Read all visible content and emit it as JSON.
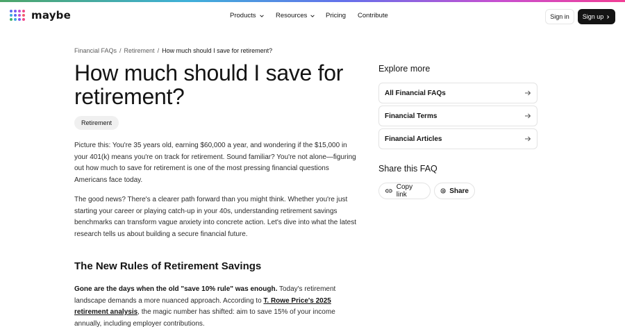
{
  "colors": {
    "accent_dark": "#141414",
    "tag_bg": "#f0f0f0",
    "border": "#e3e3e3"
  },
  "header": {
    "logo_text": "maybe",
    "nav": {
      "products": "Products",
      "resources": "Resources",
      "pricing": "Pricing",
      "contribute": "Contribute"
    },
    "sign_in": "Sign in",
    "sign_up": "Sign up"
  },
  "breadcrumb": {
    "items": [
      "Financial FAQs",
      "Retirement",
      "How much should I save for retirement?"
    ],
    "separator": "/"
  },
  "article": {
    "title": "How much should I save for retirement?",
    "tag": "Retirement",
    "p1": "Picture this: You're 35 years old, earning $60,000 a year, and wondering if the $15,000 in your 401(k) means you're on track for retirement. Sound familiar? You're not alone—figuring out how much to save for retirement is one of the most pressing financial questions Americans face today.",
    "p2": "The good news? There's a clearer path forward than you might think. Whether you're just starting your career or playing catch-up in your 40s, understanding retirement savings benchmarks can transform vague anxiety into concrete action. Let's dive into what the latest research tells us about building a secure financial future.",
    "h2": "The New Rules of Retirement Savings",
    "p3_bold": "Gone are the days when the old \"save 10% rule\" was enough.",
    "p3_a": " Today's retirement landscape demands a more nuanced approach. According to ",
    "p3_link": "T. Rowe Price's 2025 retirement analysis",
    "p3_b": ", the magic number has shifted: aim to save 15% of your income annually, including employer contributions."
  },
  "sidebar": {
    "explore_title": "Explore more",
    "links": [
      "All Financial FAQs",
      "Financial Terms",
      "Financial Articles"
    ],
    "share_title": "Share this FAQ",
    "copy_link": "Copy link",
    "share": "Share"
  },
  "icons": [
    "logo-mark-icon",
    "chevron-down-icon",
    "chevron-right-icon",
    "arrow-right-icon",
    "link-icon",
    "threads-icon"
  ]
}
